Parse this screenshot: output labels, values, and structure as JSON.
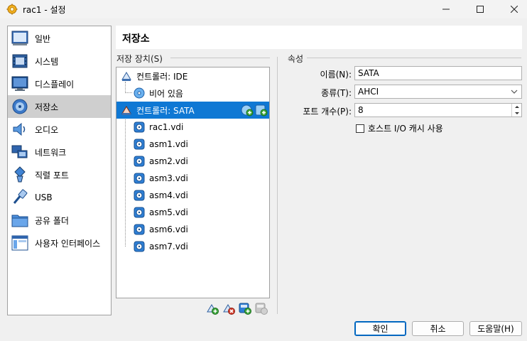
{
  "window": {
    "title": "rac1 - 설정"
  },
  "sidebar": {
    "items": [
      {
        "label": "일반",
        "icon": "general-icon"
      },
      {
        "label": "시스템",
        "icon": "system-icon"
      },
      {
        "label": "디스플레이",
        "icon": "display-icon"
      },
      {
        "label": "저장소",
        "icon": "storage-icon",
        "selected": true
      },
      {
        "label": "오디오",
        "icon": "audio-icon"
      },
      {
        "label": "네트워크",
        "icon": "network-icon"
      },
      {
        "label": "직렬 포트",
        "icon": "serial-port-icon"
      },
      {
        "label": "USB",
        "icon": "usb-icon"
      },
      {
        "label": "공유 폴더",
        "icon": "shared-folder-icon"
      },
      {
        "label": "사용자 인터페이스",
        "icon": "user-interface-icon"
      }
    ]
  },
  "page": {
    "title": "저장소"
  },
  "storage_devices": {
    "label": "저장 장치(S)",
    "tree": [
      {
        "label": "컨트롤러: IDE",
        "type": "controller"
      },
      {
        "label": "비어 있음",
        "type": "optical"
      },
      {
        "label": "컨트롤러: SATA",
        "type": "controller",
        "selected": true
      },
      {
        "label": "rac1.vdi",
        "type": "disk"
      },
      {
        "label": "asm1.vdi",
        "type": "disk"
      },
      {
        "label": "asm2.vdi",
        "type": "disk"
      },
      {
        "label": "asm3.vdi",
        "type": "disk"
      },
      {
        "label": "asm4.vdi",
        "type": "disk"
      },
      {
        "label": "asm5.vdi",
        "type": "disk"
      },
      {
        "label": "asm6.vdi",
        "type": "disk"
      },
      {
        "label": "asm7.vdi",
        "type": "disk"
      }
    ],
    "toolbar": [
      "add-controller-icon",
      "remove-controller-icon",
      "add-attachment-icon",
      "remove-attachment-icon"
    ]
  },
  "attributes": {
    "label": "속성",
    "name_label": "이름(N):",
    "name_value": "SATA",
    "type_label": "종류(T):",
    "type_value": "AHCI",
    "port_count_label": "포트 개수(P):",
    "port_count_value": "8",
    "host_io_cache_label": "호스트 I/O 캐시 사용",
    "host_io_cache_checked": false
  },
  "buttons": {
    "ok": "확인",
    "cancel": "취소",
    "help": "도움말(H)"
  },
  "colors": {
    "selection": "#0f78d4",
    "sidebar_selection": "#cfcfcf",
    "accent_border": "#0067c0"
  }
}
